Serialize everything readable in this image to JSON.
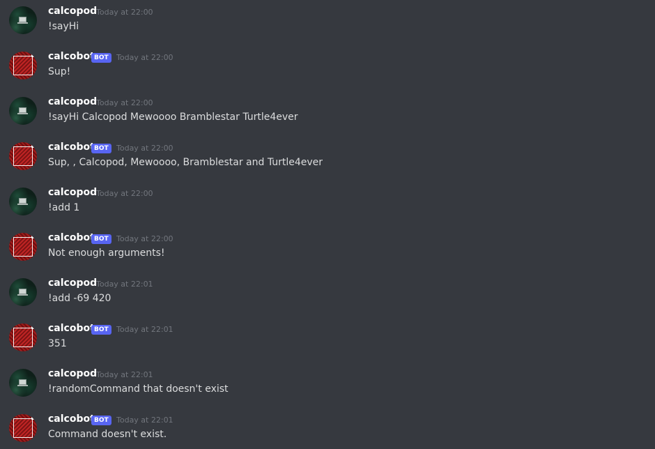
{
  "messages": [
    {
      "author": "calcopod",
      "type": "user",
      "timestamp": "Today at 22:00",
      "content": "!sayHi"
    },
    {
      "author": "calcobot",
      "type": "bot",
      "badge": "BOT",
      "timestamp": "Today at 22:00",
      "content": "Sup!"
    },
    {
      "author": "calcopod",
      "type": "user",
      "timestamp": "Today at 22:00",
      "content": "!sayHi Calcopod Mewoooo Bramblestar Turtle4ever"
    },
    {
      "author": "calcobot",
      "type": "bot",
      "badge": "BOT",
      "timestamp": "Today at 22:00",
      "content": "Sup, , Calcopod, Mewoooo, Bramblestar and Turtle4ever"
    },
    {
      "author": "calcopod",
      "type": "user",
      "timestamp": "Today at 22:00",
      "content": "!add 1"
    },
    {
      "author": "calcobot",
      "type": "bot",
      "badge": "BOT",
      "timestamp": "Today at 22:00",
      "content": "Not enough arguments!"
    },
    {
      "author": "calcopod",
      "type": "user",
      "timestamp": "Today at 22:01",
      "content": "!add -69 420"
    },
    {
      "author": "calcobot",
      "type": "bot",
      "badge": "BOT",
      "timestamp": "Today at 22:01",
      "content": "351"
    },
    {
      "author": "calcopod",
      "type": "user",
      "timestamp": "Today at 22:01",
      "content": "!randomCommand that doesn't exist"
    },
    {
      "author": "calcobot",
      "type": "bot",
      "badge": "BOT",
      "timestamp": "Today at 22:01",
      "content": "Command doesn't exist."
    }
  ],
  "colors": {
    "background": "#36393f",
    "username": "#ffffff",
    "message_text": "#dcddde",
    "timestamp": "#72767d",
    "bot_badge": "#5865f2"
  },
  "icons": {
    "user_avatar": "laptop-avatar-icon",
    "bot_avatar": "red-pattern-avatar-icon"
  }
}
